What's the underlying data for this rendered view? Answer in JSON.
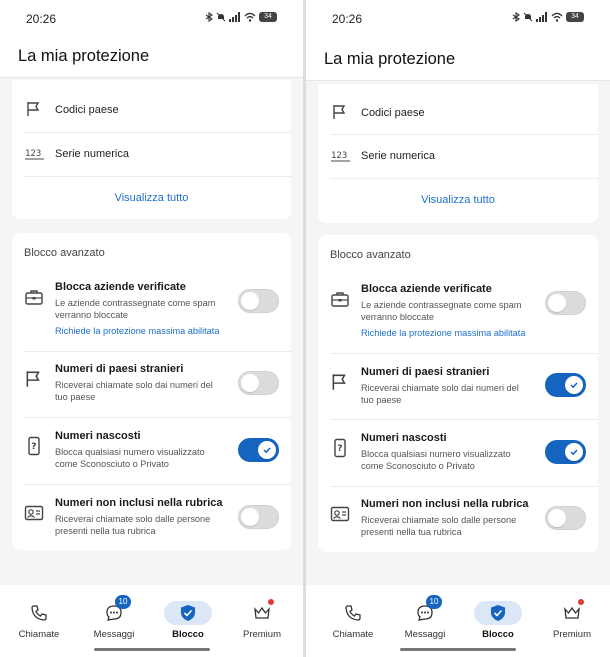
{
  "colors": {
    "accent": "#1565c0",
    "link": "#1d6fc9",
    "badge_dot": "#e53935"
  },
  "screens": [
    {
      "status": {
        "time": "20:26",
        "battery": "34"
      },
      "app_title": "La mia protezione",
      "list": {
        "items": [
          {
            "label": "Codici paese",
            "icon": "flag-icon"
          },
          {
            "label": "Serie numerica",
            "icon": "number-series-icon"
          }
        ],
        "view_all": "Visualizza tutto"
      },
      "advanced": {
        "title": "Blocco avanzato",
        "options": [
          {
            "title": "Blocca aziende verificate",
            "desc": "Le aziende contrassegnate come spam verranno bloccate",
            "link": "Richiede la protezione massima abilitata",
            "icon": "briefcase-icon",
            "on": false
          },
          {
            "title": "Numeri di paesi stranieri",
            "desc": "Riceverai chiamate solo dai numeri del tuo paese",
            "icon": "flag-icon",
            "on": false
          },
          {
            "title": "Numeri nascosti",
            "desc": "Blocca qualsiasi numero visualizzato come Sconosciuto o Privato",
            "icon": "question-phone-icon",
            "on": true
          },
          {
            "title": "Numeri non inclusi nella rubrica",
            "desc": "Riceverai chiamate solo dalle persone presenti nella tua rubrica",
            "icon": "contact-card-icon",
            "on": false
          }
        ]
      },
      "nav": [
        {
          "label": "Chiamate",
          "icon": "phone-icon"
        },
        {
          "label": "Messaggi",
          "icon": "chat-icon",
          "badge": "10"
        },
        {
          "label": "Blocco",
          "icon": "shield-check-icon",
          "active": true
        },
        {
          "label": "Premium",
          "icon": "crown-icon",
          "dot": true
        }
      ]
    },
    {
      "status": {
        "time": "20:26",
        "battery": "34"
      },
      "app_title": "La mia protezione",
      "list": {
        "items": [
          {
            "label": "Codici paese",
            "icon": "flag-icon"
          },
          {
            "label": "Serie numerica",
            "icon": "number-series-icon"
          }
        ],
        "view_all": "Visualizza tutto"
      },
      "advanced": {
        "title": "Blocco avanzato",
        "options": [
          {
            "title": "Blocca aziende verificate",
            "desc": "Le aziende contrassegnate come spam verranno bloccate",
            "link": "Richiede la protezione massima abilitata",
            "icon": "briefcase-icon",
            "on": false
          },
          {
            "title": "Numeri di paesi stranieri",
            "desc": "Riceverai chiamate solo dai numeri del tuo paese",
            "icon": "flag-icon",
            "on": true
          },
          {
            "title": "Numeri nascosti",
            "desc": "Blocca qualsiasi numero visualizzato come Sconosciuto o Privato",
            "icon": "question-phone-icon",
            "on": true
          },
          {
            "title": "Numeri non inclusi nella rubrica",
            "desc": "Riceverai chiamate solo dalle persone presenti nella tua rubrica",
            "icon": "contact-card-icon",
            "on": false
          }
        ]
      },
      "nav": [
        {
          "label": "Chiamate",
          "icon": "phone-icon"
        },
        {
          "label": "Messaggi",
          "icon": "chat-icon",
          "badge": "10"
        },
        {
          "label": "Blocco",
          "icon": "shield-check-icon",
          "active": true
        },
        {
          "label": "Premium",
          "icon": "crown-icon",
          "dot": true
        }
      ]
    }
  ]
}
